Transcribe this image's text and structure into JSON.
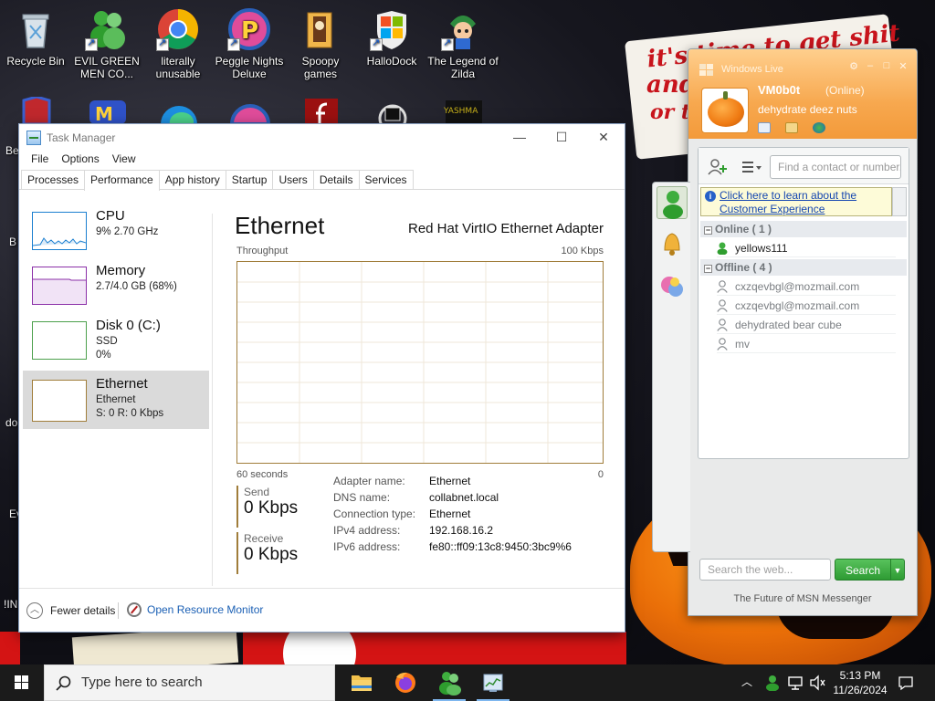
{
  "desktop": {
    "icons": [
      {
        "label": "Recycle Bin",
        "color": "#cfd8e0"
      },
      {
        "label": "EVIL GREEN MEN CO...",
        "color": "#2e9d2e"
      },
      {
        "label": "literally unusable",
        "color": "#e3a21a"
      },
      {
        "label": "Peggle Nights Deluxe",
        "color": "#e04c9a"
      },
      {
        "label": "Spoopy games",
        "color": "#d88a2e"
      },
      {
        "label": "HalloDock",
        "color": "#f25022"
      },
      {
        "label": "The Legend of Zilda",
        "color": "#2f8ad0"
      }
    ],
    "partial_labels": [
      "YASHMA",
      "Be",
      "B",
      "do",
      "Ev",
      "!IN"
    ]
  },
  "task_manager": {
    "title": "Task Manager",
    "menu": [
      "File",
      "Options",
      "View"
    ],
    "tabs": [
      "Processes",
      "Performance",
      "App history",
      "Startup",
      "Users",
      "Details",
      "Services"
    ],
    "active_tab": "Performance",
    "resources": [
      {
        "name": "CPU",
        "line1": "9%  2.70 GHz",
        "line2": "",
        "color": "#1b7fd0"
      },
      {
        "name": "Memory",
        "line1": "2.7/4.0 GB (68%)",
        "line2": "",
        "color": "#8b2fa8"
      },
      {
        "name": "Disk 0 (C:)",
        "line1": "SSD",
        "line2": "0%",
        "color": "#4ca04c"
      },
      {
        "name": "Ethernet",
        "line1": "Ethernet",
        "line2": "S: 0  R: 0 Kbps",
        "color": "#a07d3a"
      }
    ],
    "detail": {
      "title": "Ethernet",
      "adapter": "Red Hat VirtIO Ethernet Adapter",
      "graph_label": "Throughput",
      "graph_max": "100 Kbps",
      "time_label": "60 seconds",
      "time_zero": "0",
      "send_label": "Send",
      "send_value": "0 Kbps",
      "receive_label": "Receive",
      "receive_value": "0 Kbps",
      "properties": [
        {
          "key": "Adapter name:",
          "value": "Ethernet"
        },
        {
          "key": "DNS name:",
          "value": "collabnet.local"
        },
        {
          "key": "Connection type:",
          "value": "Ethernet"
        },
        {
          "key": "IPv4 address:",
          "value": "192.168.16.2"
        },
        {
          "key": "IPv6 address:",
          "value": "fe80::ff09:13c8:9450:3bc9%6"
        }
      ]
    },
    "footer": {
      "fewer_details": "Fewer details",
      "open_resource_monitor": "Open Resource Monitor"
    }
  },
  "messenger": {
    "title": "Windows Live",
    "user_name": "VM0b0t",
    "status": "(Online)",
    "personal_message": "dehydrate deez nuts",
    "find_placeholder": "Find a contact or number...",
    "info_text": "Click here to learn about the Customer Experience",
    "groups": [
      {
        "label": "Online ( 1 )",
        "contacts": [
          {
            "name": "yellows111",
            "online": true
          }
        ]
      },
      {
        "label": "Offline ( 4 )",
        "contacts": [
          {
            "name": "cxzqevbgl@mozmail.com",
            "online": false
          },
          {
            "name": "cxzqevbgl@mozmail.com",
            "online": false
          },
          {
            "name": "dehydrated bear cube",
            "online": false
          },
          {
            "name": "mv",
            "online": false
          }
        ]
      }
    ],
    "web_search_placeholder": "Search the web...",
    "search_button": "Search",
    "tagline": "The Future of MSN Messenger"
  },
  "wallpaper_text": {
    "line1": "it's time to get shit",
    "line2": "and",
    "line3": "or t"
  },
  "taskbar": {
    "search_placeholder": "Type here to search",
    "time": "5:13 PM",
    "date": "11/26/2024"
  },
  "colors": {
    "accent_orange": "#f7a84f",
    "ethernet_gold": "#a07d3a",
    "link_blue": "#1a5fb4",
    "msn_green": "#2e9b33"
  }
}
